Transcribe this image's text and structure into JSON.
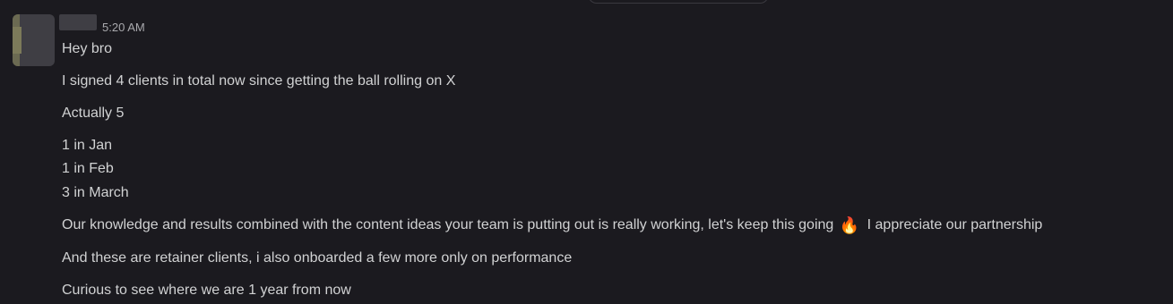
{
  "message": {
    "timestamp": "5:20 AM",
    "lines": {
      "l1": "Hey bro",
      "l2": "I signed 4 clients in total now since getting the ball rolling on X",
      "l3": "Actually 5",
      "l4": "1 in Jan",
      "l5": "1 in Feb",
      "l6": "3 in March",
      "l7a": "Our knowledge and results combined with the content ideas your team is putting out is really working, let's keep this going",
      "l7_emoji": "🔥",
      "l7b": "I appreciate our partnership",
      "l8": "And these are retainer clients, i also onboarded a few more only on performance",
      "l9": "Curious to see where we are 1 year from now"
    }
  }
}
